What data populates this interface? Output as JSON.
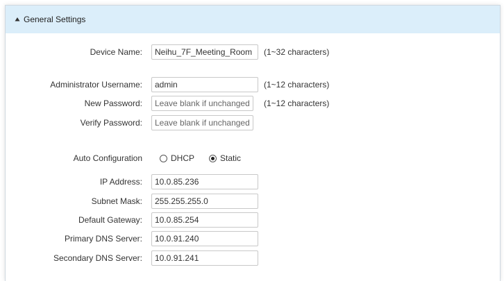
{
  "section": {
    "title": "General Settings"
  },
  "device": {
    "label": "Device Name:",
    "value": "Neihu_7F_Meeting_Room",
    "hint": "(1~32 characters)"
  },
  "admin": {
    "username_label": "Administrator Username:",
    "username_value": "admin",
    "username_hint": "(1~12 characters)",
    "new_password_label": "New Password:",
    "new_password_placeholder": "Leave blank if unchanged",
    "new_password_hint": "(1~12 characters)",
    "verify_password_label": "Verify Password:",
    "verify_password_placeholder": "Leave blank if unchanged"
  },
  "network": {
    "auto_config_label": "Auto Configuration",
    "dhcp_label": "DHCP",
    "static_label": "Static",
    "selected_mode": "Static",
    "ip_label": "IP Address:",
    "ip_value": "10.0.85.236",
    "subnet_label": "Subnet Mask:",
    "subnet_value": "255.255.255.0",
    "gateway_label": "Default Gateway:",
    "gateway_value": "10.0.85.254",
    "dns1_label": "Primary DNS Server:",
    "dns1_value": "10.0.91.240",
    "dns2_label": "Secondary DNS Server:",
    "dns2_value": "10.0.91.241"
  }
}
